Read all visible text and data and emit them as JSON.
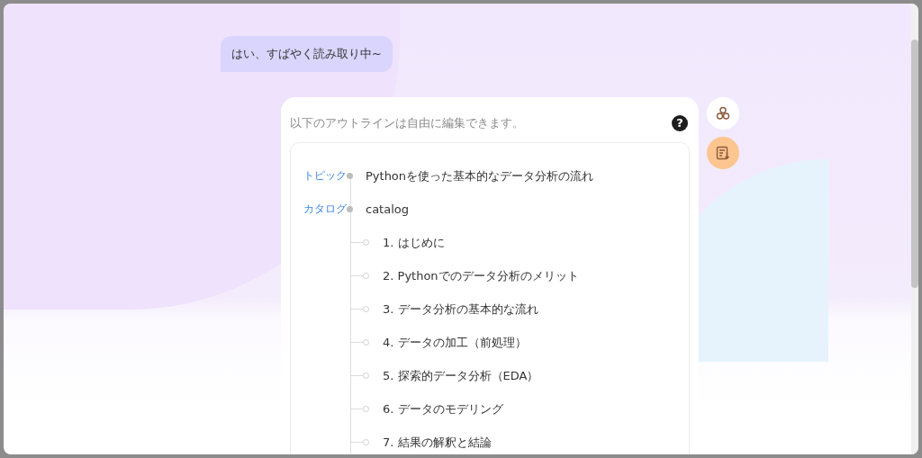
{
  "message": {
    "text": "はい、すばやく読み取り中~"
  },
  "outline": {
    "hint": "以下のアウトラインは自由に編集できます。",
    "help": "?",
    "topic": {
      "label": "トピック",
      "value": "Pythonを使った基本的なデータ分析の流れ"
    },
    "catalog": {
      "label": "カタログ",
      "value": "catalog",
      "items": [
        "1. はじめに",
        "2. Pythonでのデータ分析のメリット",
        "3. データ分析の基本的な流れ",
        "4. データの加工（前処理）",
        "5. 探索的データ分析（EDA）",
        "6. データのモデリング",
        "7. 結果の解釈と結論"
      ]
    }
  }
}
